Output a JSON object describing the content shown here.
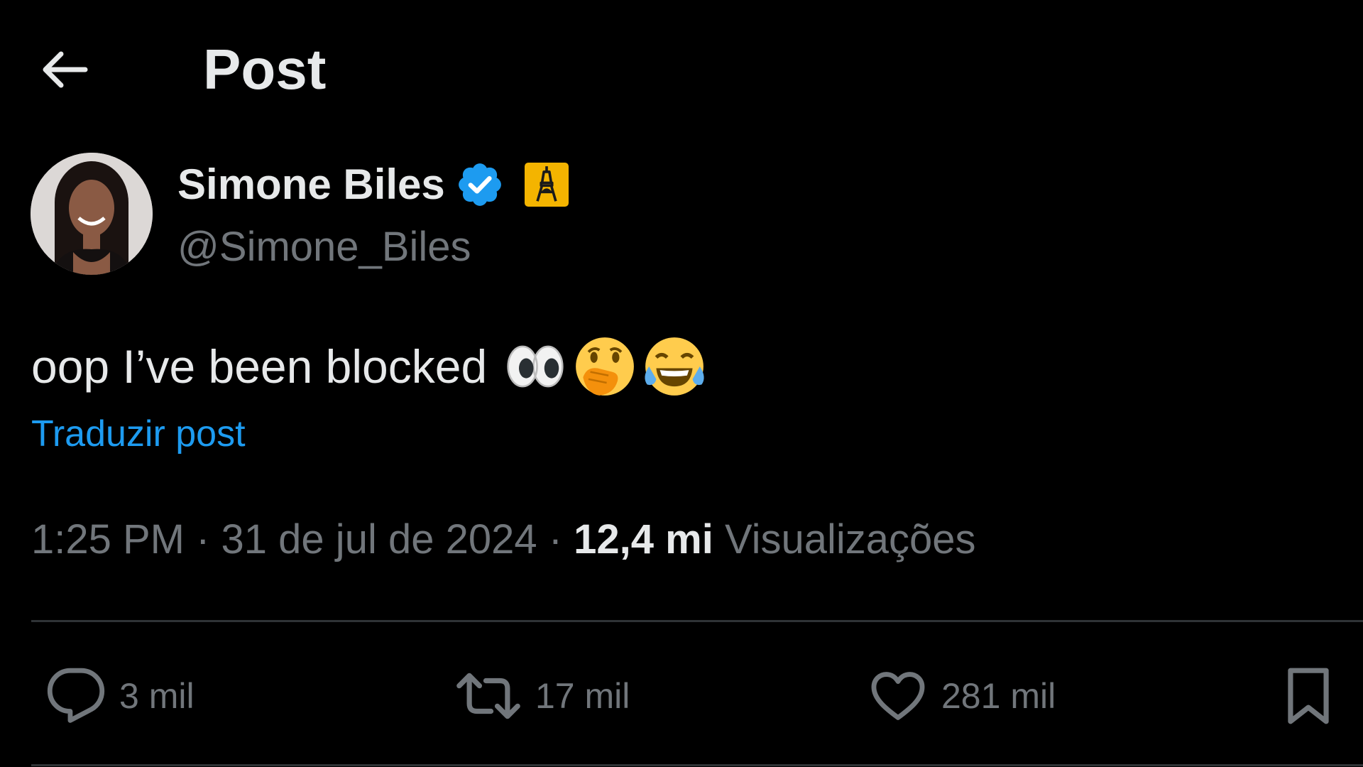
{
  "header": {
    "title": "Post",
    "back_icon": "arrow-left-icon"
  },
  "author": {
    "display_name": "Simone Biles",
    "handle": "@Simone_Biles",
    "verified_icon": "verified-badge-icon",
    "affiliation_icon": "eiffel-tower-badge-icon",
    "verified_color": "#1d9bf0",
    "affiliation_color": "#f4b400"
  },
  "post": {
    "text": "oop I’ve been blocked",
    "emojis": [
      "eyes-emoji",
      "face-with-hand-over-mouth-emoji",
      "tears-of-joy-emoji"
    ],
    "translate_label": "Traduzir post"
  },
  "meta": {
    "time": "1:25 PM",
    "separator": " · ",
    "date": "31 de jul de 2024",
    "views_count": "12,4 mi",
    "views_label": "Visualizações"
  },
  "actions": {
    "reply": {
      "icon": "reply-icon",
      "count": "3 mil"
    },
    "repost": {
      "icon": "repost-icon",
      "count": "17 mil"
    },
    "like": {
      "icon": "heart-icon",
      "count": "281 mil"
    },
    "bookmark": {
      "icon": "bookmark-icon"
    }
  },
  "colors": {
    "background": "#000000",
    "primary_text": "#e7e9ea",
    "secondary_text": "#71767b",
    "link": "#1d9bf0",
    "divider": "#2f3336"
  }
}
